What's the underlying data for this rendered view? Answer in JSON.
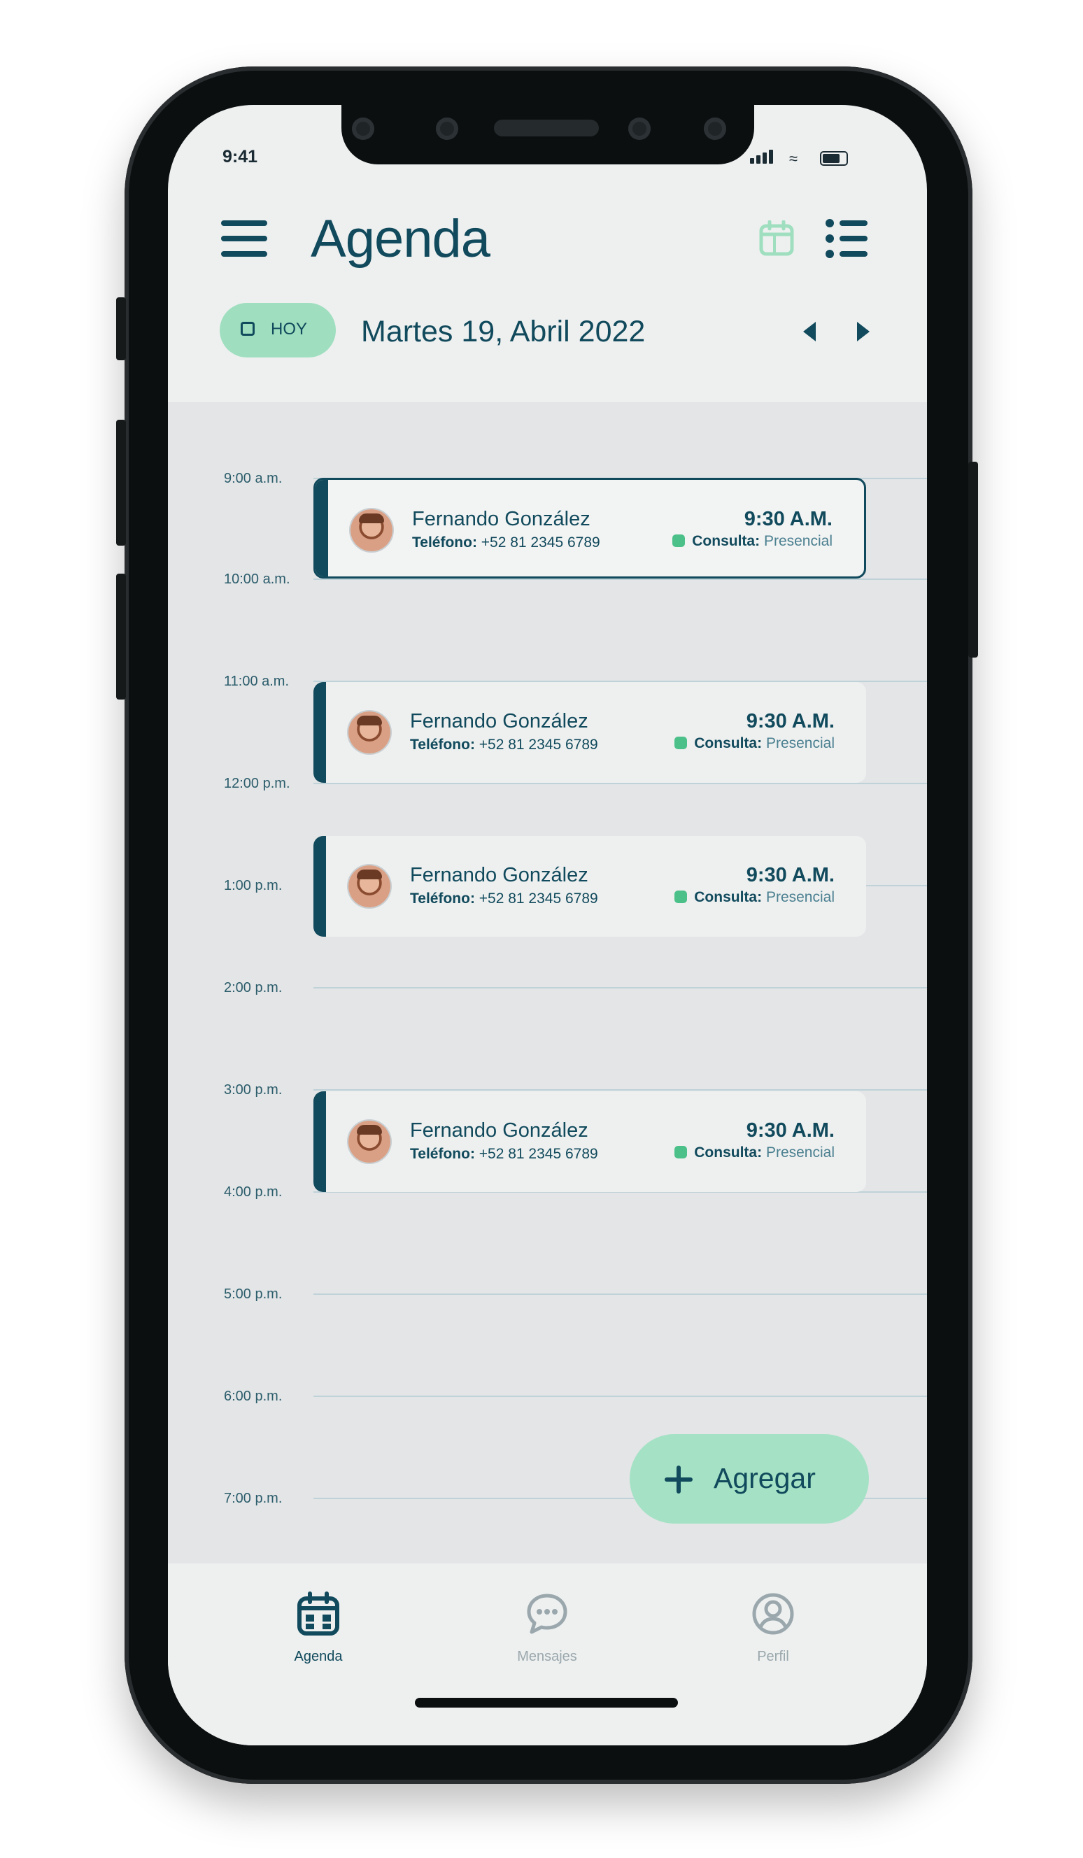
{
  "status_bar": {
    "time": "9:41"
  },
  "header": {
    "title": "Agenda"
  },
  "date_bar": {
    "today_label": "HOY",
    "date": "Martes 19, Abril 2022"
  },
  "time_slots": [
    "9:00 a.m.",
    "10:00 a.m.",
    "11:00 a.m.",
    "12:00 p.m.",
    "1:00 p.m.",
    "2:00 p.m.",
    "3:00 p.m.",
    "4:00 p.m.",
    "5:00 p.m.",
    "6:00 p.m.",
    "7:00 p.m."
  ],
  "appointments": [
    {
      "name": "Fernando González",
      "phone_label": "Teléfono:",
      "phone": "+52 81 2345 6789",
      "time": "9:30 A.M.",
      "type_label": "Consulta:",
      "mode": "Presencial",
      "selected": true
    },
    {
      "name": "Fernando González",
      "phone_label": "Teléfono:",
      "phone": "+52 81 2345 6789",
      "time": "9:30 A.M.",
      "type_label": "Consulta:",
      "mode": "Presencial",
      "selected": false
    },
    {
      "name": "Fernando González",
      "phone_label": "Teléfono:",
      "phone": "+52 81 2345 6789",
      "time": "9:30 A.M.",
      "type_label": "Consulta:",
      "mode": "Presencial",
      "selected": false
    },
    {
      "name": "Fernando González",
      "phone_label": "Teléfono:",
      "phone": "+52 81 2345 6789",
      "time": "9:30 A.M.",
      "type_label": "Consulta:",
      "mode": "Presencial",
      "selected": false
    }
  ],
  "fab": {
    "label": "Agregar"
  },
  "bottom_nav": [
    {
      "label": "Agenda",
      "icon": "calendar-icon",
      "active": true
    },
    {
      "label": "Mensajes",
      "icon": "chat-icon",
      "active": false
    },
    {
      "label": "Perfil",
      "icon": "profile-icon",
      "active": false
    }
  ],
  "colors": {
    "primary": "#114a5c",
    "accent": "#9fdfbf",
    "status_green": "#4cc089",
    "background": "#eef0f0"
  }
}
